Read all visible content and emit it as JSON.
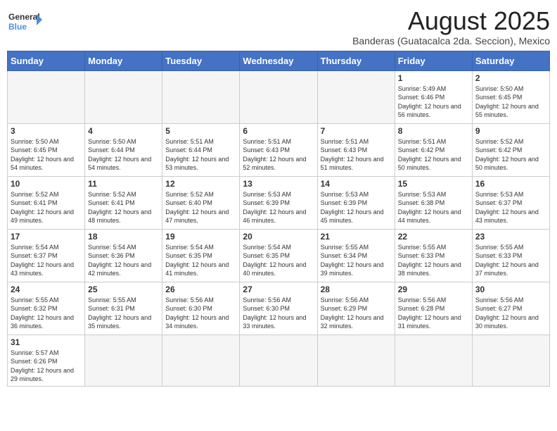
{
  "header": {
    "logo_general": "General",
    "logo_blue": "Blue",
    "month_title": "August 2025",
    "subtitle": "Banderas (Guatacalca 2da. Seccion), Mexico"
  },
  "weekdays": [
    "Sunday",
    "Monday",
    "Tuesday",
    "Wednesday",
    "Thursday",
    "Friday",
    "Saturday"
  ],
  "weeks": [
    [
      {
        "day": "",
        "info": ""
      },
      {
        "day": "",
        "info": ""
      },
      {
        "day": "",
        "info": ""
      },
      {
        "day": "",
        "info": ""
      },
      {
        "day": "",
        "info": ""
      },
      {
        "day": "1",
        "info": "Sunrise: 5:49 AM\nSunset: 6:46 PM\nDaylight: 12 hours and 56 minutes."
      },
      {
        "day": "2",
        "info": "Sunrise: 5:50 AM\nSunset: 6:45 PM\nDaylight: 12 hours and 55 minutes."
      }
    ],
    [
      {
        "day": "3",
        "info": "Sunrise: 5:50 AM\nSunset: 6:45 PM\nDaylight: 12 hours and 54 minutes."
      },
      {
        "day": "4",
        "info": "Sunrise: 5:50 AM\nSunset: 6:44 PM\nDaylight: 12 hours and 54 minutes."
      },
      {
        "day": "5",
        "info": "Sunrise: 5:51 AM\nSunset: 6:44 PM\nDaylight: 12 hours and 53 minutes."
      },
      {
        "day": "6",
        "info": "Sunrise: 5:51 AM\nSunset: 6:43 PM\nDaylight: 12 hours and 52 minutes."
      },
      {
        "day": "7",
        "info": "Sunrise: 5:51 AM\nSunset: 6:43 PM\nDaylight: 12 hours and 51 minutes."
      },
      {
        "day": "8",
        "info": "Sunrise: 5:51 AM\nSunset: 6:42 PM\nDaylight: 12 hours and 50 minutes."
      },
      {
        "day": "9",
        "info": "Sunrise: 5:52 AM\nSunset: 6:42 PM\nDaylight: 12 hours and 50 minutes."
      }
    ],
    [
      {
        "day": "10",
        "info": "Sunrise: 5:52 AM\nSunset: 6:41 PM\nDaylight: 12 hours and 49 minutes."
      },
      {
        "day": "11",
        "info": "Sunrise: 5:52 AM\nSunset: 6:41 PM\nDaylight: 12 hours and 48 minutes."
      },
      {
        "day": "12",
        "info": "Sunrise: 5:52 AM\nSunset: 6:40 PM\nDaylight: 12 hours and 47 minutes."
      },
      {
        "day": "13",
        "info": "Sunrise: 5:53 AM\nSunset: 6:39 PM\nDaylight: 12 hours and 46 minutes."
      },
      {
        "day": "14",
        "info": "Sunrise: 5:53 AM\nSunset: 6:39 PM\nDaylight: 12 hours and 45 minutes."
      },
      {
        "day": "15",
        "info": "Sunrise: 5:53 AM\nSunset: 6:38 PM\nDaylight: 12 hours and 44 minutes."
      },
      {
        "day": "16",
        "info": "Sunrise: 5:53 AM\nSunset: 6:37 PM\nDaylight: 12 hours and 43 minutes."
      }
    ],
    [
      {
        "day": "17",
        "info": "Sunrise: 5:54 AM\nSunset: 6:37 PM\nDaylight: 12 hours and 43 minutes."
      },
      {
        "day": "18",
        "info": "Sunrise: 5:54 AM\nSunset: 6:36 PM\nDaylight: 12 hours and 42 minutes."
      },
      {
        "day": "19",
        "info": "Sunrise: 5:54 AM\nSunset: 6:35 PM\nDaylight: 12 hours and 41 minutes."
      },
      {
        "day": "20",
        "info": "Sunrise: 5:54 AM\nSunset: 6:35 PM\nDaylight: 12 hours and 40 minutes."
      },
      {
        "day": "21",
        "info": "Sunrise: 5:55 AM\nSunset: 6:34 PM\nDaylight: 12 hours and 39 minutes."
      },
      {
        "day": "22",
        "info": "Sunrise: 5:55 AM\nSunset: 6:33 PM\nDaylight: 12 hours and 38 minutes."
      },
      {
        "day": "23",
        "info": "Sunrise: 5:55 AM\nSunset: 6:33 PM\nDaylight: 12 hours and 37 minutes."
      }
    ],
    [
      {
        "day": "24",
        "info": "Sunrise: 5:55 AM\nSunset: 6:32 PM\nDaylight: 12 hours and 36 minutes."
      },
      {
        "day": "25",
        "info": "Sunrise: 5:55 AM\nSunset: 6:31 PM\nDaylight: 12 hours and 35 minutes."
      },
      {
        "day": "26",
        "info": "Sunrise: 5:56 AM\nSunset: 6:30 PM\nDaylight: 12 hours and 34 minutes."
      },
      {
        "day": "27",
        "info": "Sunrise: 5:56 AM\nSunset: 6:30 PM\nDaylight: 12 hours and 33 minutes."
      },
      {
        "day": "28",
        "info": "Sunrise: 5:56 AM\nSunset: 6:29 PM\nDaylight: 12 hours and 32 minutes."
      },
      {
        "day": "29",
        "info": "Sunrise: 5:56 AM\nSunset: 6:28 PM\nDaylight: 12 hours and 31 minutes."
      },
      {
        "day": "30",
        "info": "Sunrise: 5:56 AM\nSunset: 6:27 PM\nDaylight: 12 hours and 30 minutes."
      }
    ],
    [
      {
        "day": "31",
        "info": "Sunrise: 5:57 AM\nSunset: 6:26 PM\nDaylight: 12 hours and 29 minutes."
      },
      {
        "day": "",
        "info": ""
      },
      {
        "day": "",
        "info": ""
      },
      {
        "day": "",
        "info": ""
      },
      {
        "day": "",
        "info": ""
      },
      {
        "day": "",
        "info": ""
      },
      {
        "day": "",
        "info": ""
      }
    ]
  ]
}
